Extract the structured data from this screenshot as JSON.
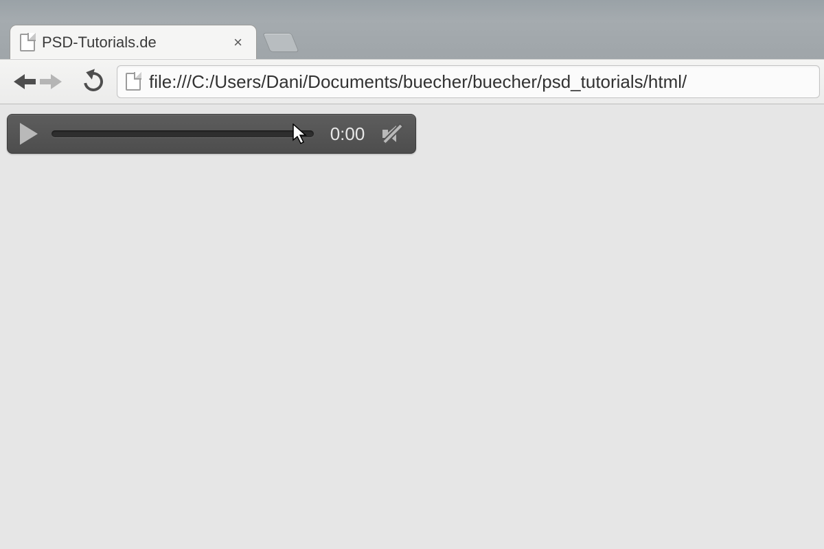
{
  "browser": {
    "tab": {
      "title": "PSD-Tutorials.de"
    },
    "url": "file:///C:/Users/Dani/Documents/buecher/buecher/psd_tutorials/html/"
  },
  "audio": {
    "time": "0:00"
  }
}
